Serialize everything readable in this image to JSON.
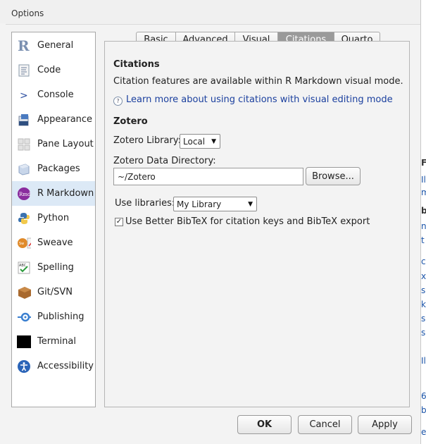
{
  "window": {
    "title": "Options"
  },
  "sidebar": {
    "items": [
      {
        "label": "General",
        "icon": "r-logo-icon",
        "selected": false
      },
      {
        "label": "Code",
        "icon": "code-document-icon",
        "selected": false
      },
      {
        "label": "Console",
        "icon": "console-prompt-icon",
        "selected": false
      },
      {
        "label": "Appearance",
        "icon": "appearance-paint-icon",
        "selected": false
      },
      {
        "label": "Pane Layout",
        "icon": "pane-layout-icon",
        "selected": false
      },
      {
        "label": "Packages",
        "icon": "packages-box-icon",
        "selected": false
      },
      {
        "label": "R Markdown",
        "icon": "rmarkdown-icon",
        "selected": true
      },
      {
        "label": "Python",
        "icon": "python-logo-icon",
        "selected": false
      },
      {
        "label": "Sweave",
        "icon": "sweave-pdf-icon",
        "selected": false
      },
      {
        "label": "Spelling",
        "icon": "spelling-check-icon",
        "selected": false
      },
      {
        "label": "Git/SVN",
        "icon": "git-svn-box-icon",
        "selected": false
      },
      {
        "label": "Publishing",
        "icon": "publishing-icon",
        "selected": false
      },
      {
        "label": "Terminal",
        "icon": "terminal-icon",
        "selected": false
      },
      {
        "label": "Accessibility",
        "icon": "accessibility-icon",
        "selected": false
      }
    ]
  },
  "tabs": [
    {
      "label": "Basic",
      "active": false
    },
    {
      "label": "Advanced",
      "active": false
    },
    {
      "label": "Visual",
      "active": false
    },
    {
      "label": "Citations",
      "active": true
    },
    {
      "label": "Quarto",
      "active": false
    }
  ],
  "citations": {
    "heading": "Citations",
    "description": "Citation features are available within R Markdown visual mode.",
    "help_link": "Learn more about using citations with visual editing mode",
    "zotero_heading": "Zotero",
    "library_label": "Zotero Library:",
    "library_value": "Local",
    "data_dir_label": "Zotero Data Directory:",
    "data_dir_value": "~/Zotero",
    "browse_label": "Browse...",
    "use_libraries_label": "Use libraries:",
    "use_libraries_value": "My Library",
    "bbt_label": "Use Better BibTeX for citation keys and BibTeX export",
    "bbt_checked": true
  },
  "footer": {
    "ok": "OK",
    "cancel": "Cancel",
    "apply": "Apply"
  },
  "background": {
    "fragments": [
      {
        "text": "F",
        "dark": true
      },
      {
        "text": "Il",
        "dark": false
      },
      {
        "text": "m",
        "dark": false
      },
      {
        "text": "b",
        "dark": true
      },
      {
        "text": "n",
        "dark": false
      },
      {
        "text": "t",
        "dark": false
      },
      {
        "text": "c",
        "dark": false
      },
      {
        "text": "x",
        "dark": false
      },
      {
        "text": "s",
        "dark": false
      },
      {
        "text": "k",
        "dark": false
      },
      {
        "text": "s",
        "dark": false
      },
      {
        "text": "s",
        "dark": false
      },
      {
        "text": "Il",
        "dark": false
      },
      {
        "text": "6",
        "dark": false
      },
      {
        "text": "b",
        "dark": false
      },
      {
        "text": "e",
        "dark": false
      }
    ]
  }
}
